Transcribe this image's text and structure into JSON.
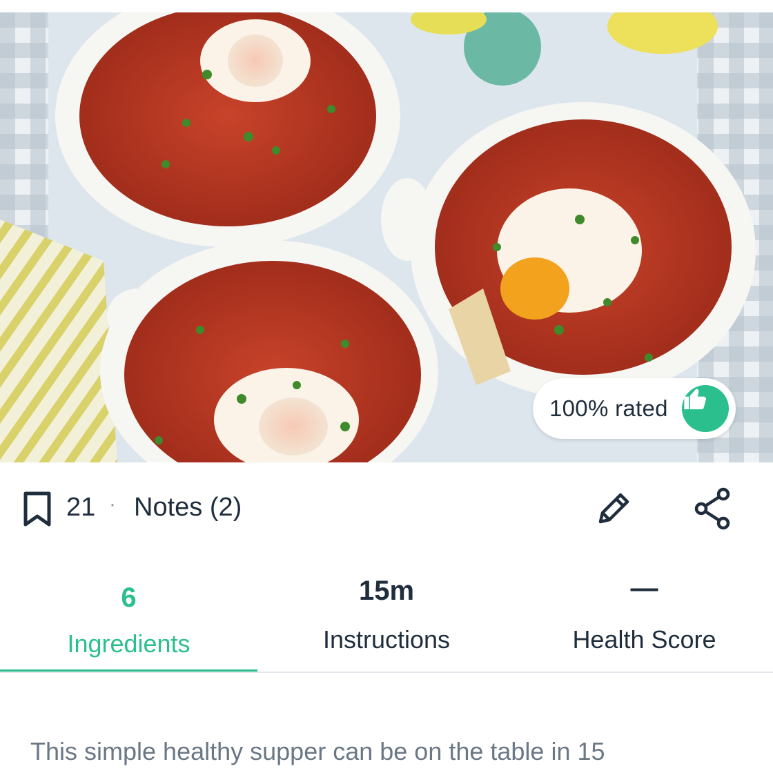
{
  "hero": {
    "image_alt": "Shakshuka-style baked eggs in tomato sauce in white dishes",
    "rating_text": "100% rated",
    "rating_icon": "thumbs-up-icon",
    "accent_color": "#2bbf8e"
  },
  "actions": {
    "bookmark_icon": "bookmark-icon",
    "save_count": "21",
    "separator": "·",
    "notes_label": "Notes (2)",
    "edit_icon": "pencil-icon",
    "share_icon": "share-icon"
  },
  "tabs": [
    {
      "value": "6",
      "label": "Ingredients",
      "active": true
    },
    {
      "value": "15m",
      "label": "Instructions",
      "active": false
    },
    {
      "value": "—",
      "label": "Health Score",
      "active": false
    }
  ],
  "description": "This simple healthy supper can be on the table in 15"
}
